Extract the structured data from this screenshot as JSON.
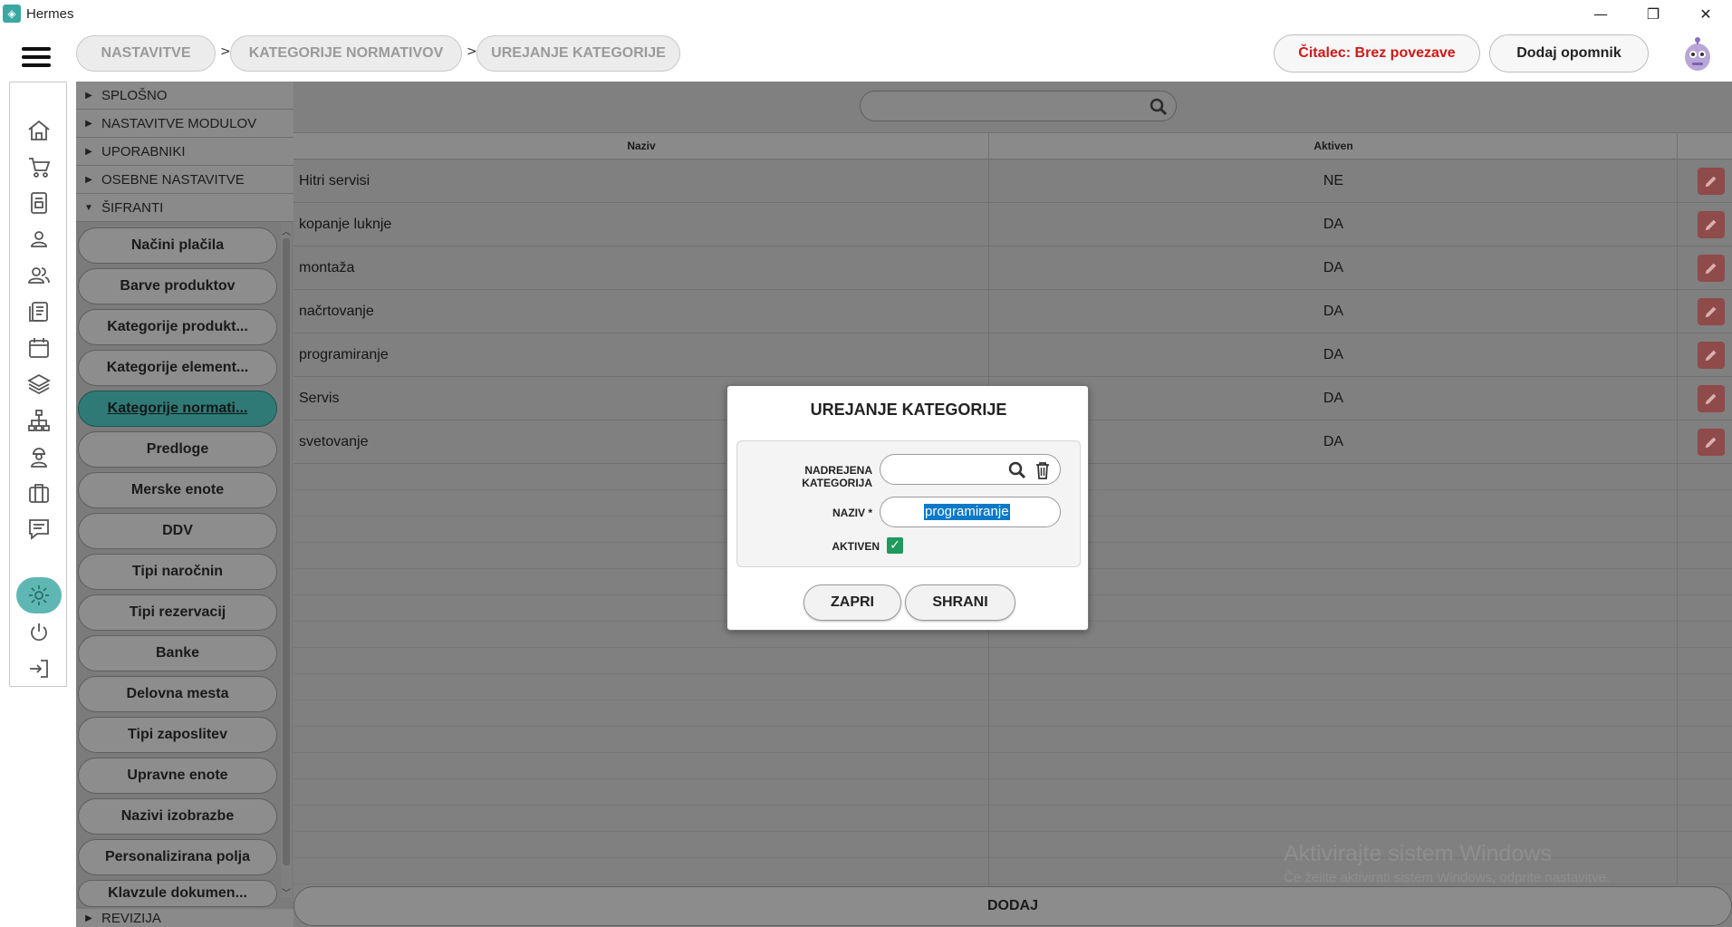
{
  "window": {
    "title": "Hermes",
    "controls": [
      "—",
      "❐",
      "✕"
    ]
  },
  "breadcrumb": [
    "NASTAVITVE",
    "KATEGORIJE NORMATIVOV",
    "UREJANJE KATEGORIJE"
  ],
  "breadcrumb_sep": ">",
  "header": {
    "reader_status": "Čitalec: Brez povezave",
    "add_reminder": "Dodaj opomnik"
  },
  "nav_icons": [
    "home-icon",
    "cart-icon",
    "document-icon",
    "person-icon",
    "people-icon",
    "news-icon",
    "calendar-icon",
    "layers-icon",
    "network-icon",
    "worker-icon",
    "briefcase-icon",
    "chat-icon",
    "settings-icon",
    "power-icon",
    "logout-icon"
  ],
  "sections": {
    "splosno": "SPLOŠNO",
    "nastavitve_modulov": "NASTAVITVE MODULOV",
    "uporabniki": "UPORABNIKI",
    "osebne_nastavitve": "OSEBNE NASTAVITVE",
    "sifranti": "ŠIFRANTI",
    "revizija": "REVIZIJA"
  },
  "sifranti_items": [
    "Načini plačila",
    "Barve produktov",
    "Kategorije produkt...",
    "Kategorije element...",
    "Kategorije normati...",
    "Predloge",
    "Merske enote",
    "DDV",
    "Tipi naročnin",
    "Tipi rezervacij",
    "Banke",
    "Delovna mesta",
    "Tipi zaposlitev",
    "Upravne enote",
    "Nazivi izobrazbe",
    "Personalizirana polja",
    "Klavzule dokumen..."
  ],
  "active_item": "Kategorije normati...",
  "table": {
    "columns": [
      "Naziv",
      "Aktiven"
    ],
    "rows": [
      {
        "naziv": "Hitri servisi",
        "aktiven": "NE"
      },
      {
        "naziv": "kopanje luknje",
        "aktiven": "DA"
      },
      {
        "naziv": "montaža",
        "aktiven": "DA"
      },
      {
        "naziv": "načrtovanje",
        "aktiven": "DA"
      },
      {
        "naziv": "programiranje",
        "aktiven": "DA"
      },
      {
        "naziv": "Servis",
        "aktiven": "DA"
      },
      {
        "naziv": "svetovanje",
        "aktiven": "DA"
      }
    ]
  },
  "add_button": "DODAJ",
  "watermark": {
    "line1": "Aktivirajte sistem Windows",
    "line2": "Če želite aktivirati sistem Windows, odprite nastavitve."
  },
  "dialog": {
    "title": "UREJANJE KATEGORIJE",
    "parent_label": "NADREJENA KATEGORIJA",
    "parent_value": "",
    "name_label": "NAZIV *",
    "name_value": "programiranje",
    "active_label": "AKTIVEN",
    "active_checked": true,
    "close_button": "ZAPRI",
    "save_button": "SHRANI"
  },
  "colors": {
    "accent": "#5fb7b3",
    "active_item": "#2f7a76",
    "reader_status": "#d01818",
    "checkbox": "#1d9a5c",
    "selection": "#0a79c8",
    "edit_button": "#8f4a4a"
  }
}
